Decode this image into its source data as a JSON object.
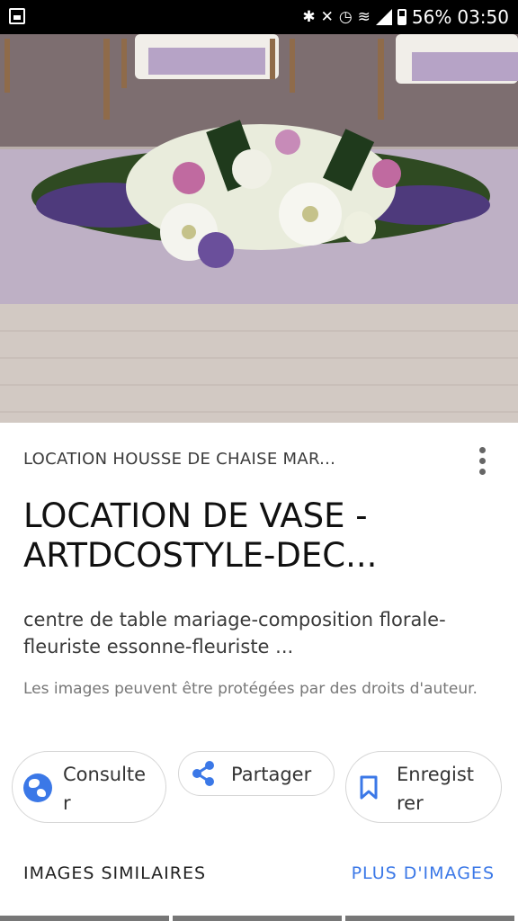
{
  "status_bar": {
    "battery": "56%",
    "time": "03:50",
    "icons": [
      "image-notification-icon",
      "bluetooth-icon",
      "mute-icon",
      "alarm-icon",
      "wifi-icon",
      "signal-icon",
      "battery-icon"
    ]
  },
  "image": {
    "subject": "floral-centerpiece-photo"
  },
  "result": {
    "source": "LOCATION HOUSSE DE CHAISE MAR...",
    "title": "LOCATION DE VASE -ARTDCOSTYLE-DEC...",
    "description": "centre de table mariage-composition florale-fleuriste essonne-fleuriste ...",
    "notice": "Les images peuvent être protégées par des droits d'auteur."
  },
  "actions": {
    "consult": "Consulte r",
    "share": "Partager",
    "save": "Enregist rer"
  },
  "footer": {
    "similar": "IMAGES SIMILAIRES",
    "more_images": "PLUS D'IMAGES"
  },
  "colors": {
    "accent": "#3b78e7",
    "text": "#111111",
    "muted": "#777777"
  }
}
